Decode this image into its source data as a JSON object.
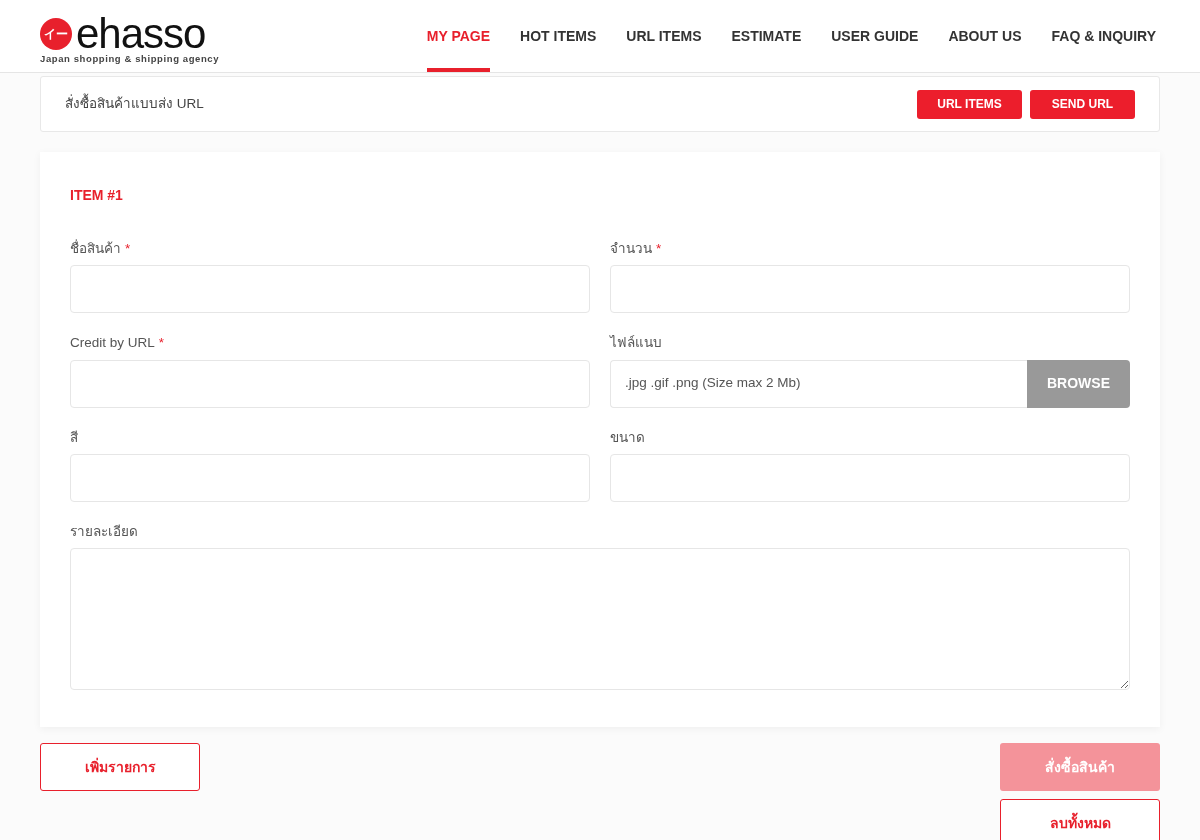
{
  "logo": {
    "mark": "イー",
    "name": "ehasso",
    "tagline": "Japan shopping & shipping agency"
  },
  "nav": [
    {
      "label": "MY PAGE",
      "selected": true
    },
    {
      "label": "HOT ITEMS",
      "selected": false
    },
    {
      "label": "URL ITEMS",
      "selected": false
    },
    {
      "label": "ESTIMATE",
      "selected": false
    },
    {
      "label": "USER GUIDE",
      "selected": false
    },
    {
      "label": "ABOUT US",
      "selected": false
    },
    {
      "label": "FAQ & INQUIRY",
      "selected": false
    }
  ],
  "breadcrumb": {
    "title": "สั่งซื้อสินค้าแบบส่ง URL",
    "buttons": [
      "URL ITEMS",
      "SEND URL"
    ]
  },
  "form": {
    "heading": "ITEM #1",
    "fields": [
      {
        "kind": "text",
        "label": "ชื่อสินค้า",
        "required_mark": "*"
      },
      {
        "kind": "text",
        "label": "จำนวน",
        "required_mark": "*"
      },
      {
        "kind": "text",
        "label": "Credit by URL",
        "required_mark": "*"
      },
      {
        "kind": "file",
        "label": "ไฟล์แนบ",
        "placeholder": ".jpg .gif .png (Size max 2 Mb)",
        "button": "BROWSE"
      },
      {
        "kind": "text",
        "label": "สี"
      },
      {
        "kind": "text",
        "label": "ขนาด"
      },
      {
        "kind": "textarea",
        "label": "รายละเอียด"
      }
    ]
  },
  "actions": {
    "add": "เพิ่มรายการ",
    "order": {
      "label": "สั่งซื้อสินค้า",
      "disabled": true
    },
    "clear": "ลบทั้งหมด"
  }
}
